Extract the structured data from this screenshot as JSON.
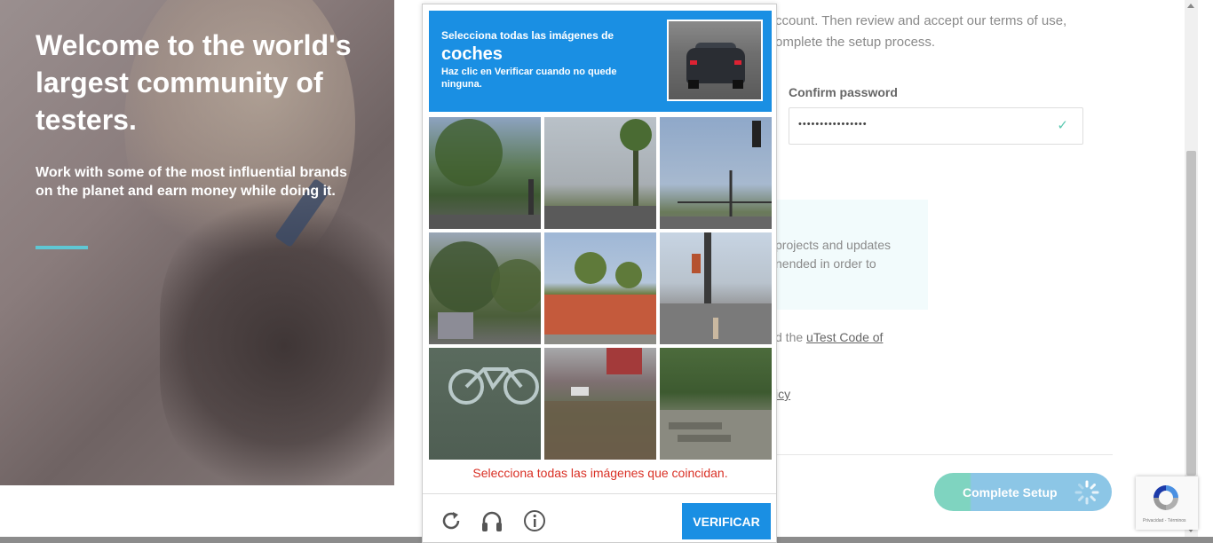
{
  "hero": {
    "title": "Welcome to the world's largest community of testers.",
    "subtitle": "Work with some of the most influential brands on the planet and earn money while doing it.",
    "accent_color": "#5fc7d4"
  },
  "form": {
    "intro": "ccount. Then review and accept our terms of use, omplete the setup process.",
    "confirm_password_label": "Confirm password",
    "confirm_password_value": "••••••••••••••••",
    "info_text": "projects and updates nended in order to",
    "code_text_prefix": "d the ",
    "code_link": "uTest Code of",
    "policy_fragment": "icy",
    "complete_button": "Complete Setup"
  },
  "captcha": {
    "instruction_line1": "Selecciona todas las imágenes de",
    "target": "coches",
    "instruction_line3": "Haz clic en Verificar cuando no quede ninguna.",
    "error": "Selecciona todas las imágenes que coincidan.",
    "verify_button": "VERIFICAR",
    "header_color": "#1a8fe3",
    "tiles": [
      {
        "name": "tile-trees-street"
      },
      {
        "name": "tile-palm-street"
      },
      {
        "name": "tile-traffic-lights"
      },
      {
        "name": "tile-trees-house"
      },
      {
        "name": "tile-palms-roof"
      },
      {
        "name": "tile-intersection"
      },
      {
        "name": "tile-bike-lane"
      },
      {
        "name": "tile-road-car"
      },
      {
        "name": "tile-sidewalk-steps"
      }
    ]
  },
  "recaptcha_badge": {
    "footer": "Privacidad - Términos"
  }
}
